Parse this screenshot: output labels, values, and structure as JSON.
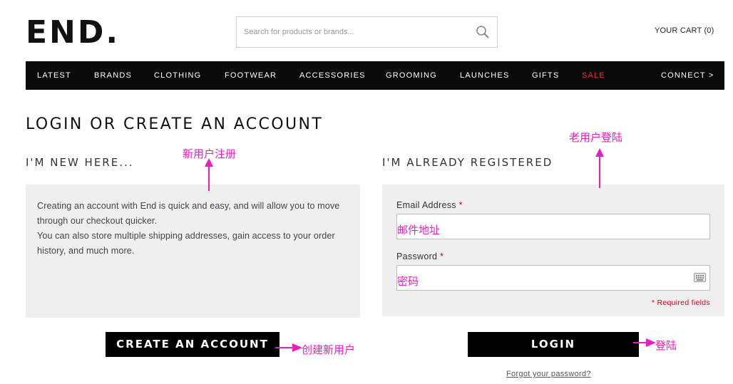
{
  "header": {
    "logo": "END.",
    "search_placeholder": "Search for products or brands...",
    "cart_label": "YOUR CART (0)"
  },
  "nav": {
    "items": [
      "LATEST",
      "BRANDS",
      "CLOTHING",
      "FOOTWEAR",
      "ACCESSORIES",
      "GROOMING",
      "LAUNCHES",
      "GIFTS",
      "SALE"
    ],
    "connect": "CONNECT >",
    "sale_color": "#e0323a"
  },
  "page": {
    "title": "LOGIN OR CREATE AN ACCOUNT"
  },
  "new_customer": {
    "heading": "I'M NEW HERE...",
    "text_line1": "Creating an account with End is quick and easy, and will allow you to move through our checkout quicker.",
    "text_line2": "You can also store multiple shipping addresses, gain access to your order history, and much more.",
    "button": "CREATE AN ACCOUNT"
  },
  "registered": {
    "heading": "I'M ALREADY REGISTERED",
    "email_label": "Email Address",
    "email_value": "邮件地址",
    "password_label": "Password",
    "password_value": "密码",
    "required_marker": "*",
    "required_note": "* Required fields",
    "button": "LOGIN",
    "forgot": "Forgot your password?"
  },
  "annotations": {
    "new_user_register": "新用户注册",
    "old_user_login": "老用户登陆",
    "create_new_user": "创建新用户",
    "login": "登陆",
    "color": "#e61fbf"
  }
}
